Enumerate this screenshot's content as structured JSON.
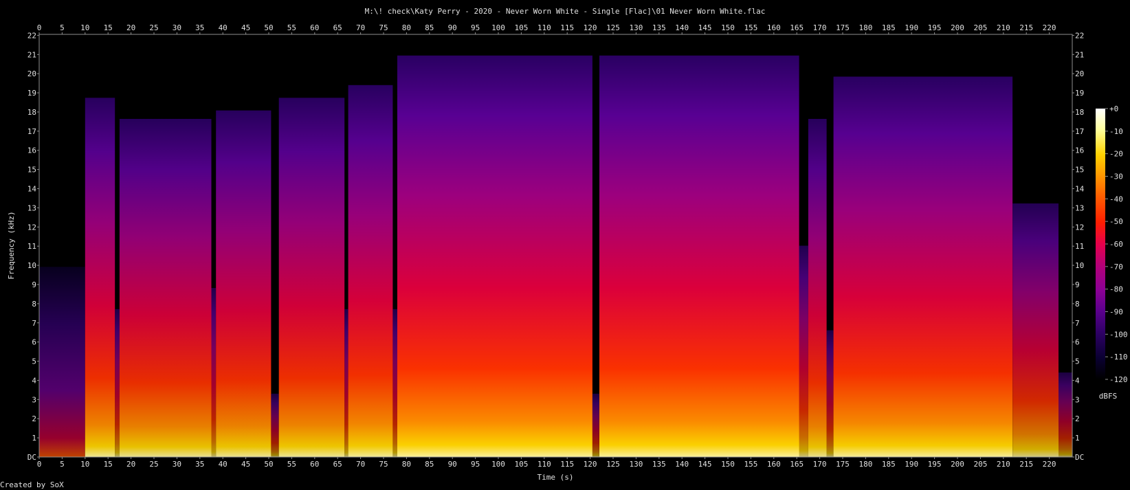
{
  "title": "M:\\! check\\Katy Perry - 2020 - Never Worn White - Single [Flac]\\01 Never Worn White.flac",
  "footer": "Created by SoX",
  "chart_data": {
    "type": "heatmap",
    "title": "M:\\! check\\Katy Perry - 2020 - Never Worn White - Single [Flac]\\01 Never Worn White.flac",
    "xlabel": "Time (s)",
    "ylabel": "Frequency (kHz)",
    "xlim": [
      0,
      225
    ],
    "ylim": [
      0,
      22.05
    ],
    "x_ticks": [
      0,
      5,
      10,
      15,
      20,
      25,
      30,
      35,
      40,
      45,
      50,
      55,
      60,
      65,
      70,
      75,
      80,
      85,
      90,
      95,
      100,
      105,
      110,
      115,
      120,
      125,
      130,
      135,
      140,
      145,
      150,
      155,
      160,
      165,
      170,
      175,
      180,
      185,
      190,
      195,
      200,
      205,
      210,
      215,
      220
    ],
    "y_tick_labels": [
      "DC",
      "1",
      "2",
      "3",
      "4",
      "5",
      "6",
      "7",
      "8",
      "9",
      "10",
      "11",
      "12",
      "13",
      "14",
      "15",
      "16",
      "17",
      "18",
      "19",
      "20",
      "21",
      "22"
    ],
    "colorbar": {
      "label": "dBFS",
      "range": [
        -120,
        0
      ],
      "ticks": [
        "+0",
        "-10",
        "-20",
        "-30",
        "-40",
        "-50",
        "-60",
        "-70",
        "-80",
        "-90",
        "-100",
        "-110",
        "-120"
      ],
      "colors": [
        "#ffffff",
        "#ffff99",
        "#ffd200",
        "#ff9600",
        "#ff5a00",
        "#ff1e00",
        "#e6004b",
        "#b40078",
        "#8c0096",
        "#5a008c",
        "#2d0064",
        "#0a0032",
        "#000000"
      ]
    },
    "time_segments": [
      {
        "start": 0,
        "end": 10,
        "level": 0.45
      },
      {
        "start": 10,
        "end": 16.5,
        "level": 0.85
      },
      {
        "start": 16.5,
        "end": 17.5,
        "level": 0.35
      },
      {
        "start": 17.5,
        "end": 37.5,
        "level": 0.8
      },
      {
        "start": 37.5,
        "end": 38.5,
        "level": 0.4
      },
      {
        "start": 38.5,
        "end": 50.5,
        "level": 0.82
      },
      {
        "start": 50.5,
        "end": 52.2,
        "level": 0.15
      },
      {
        "start": 52.2,
        "end": 66.5,
        "level": 0.85
      },
      {
        "start": 66.5,
        "end": 67.3,
        "level": 0.35
      },
      {
        "start": 67.3,
        "end": 77,
        "level": 0.88
      },
      {
        "start": 77,
        "end": 78,
        "level": 0.35
      },
      {
        "start": 78,
        "end": 120.5,
        "level": 0.95
      },
      {
        "start": 120.5,
        "end": 122,
        "level": 0.15
      },
      {
        "start": 122,
        "end": 165.5,
        "level": 0.95
      },
      {
        "start": 165.5,
        "end": 167.5,
        "level": 0.5
      },
      {
        "start": 167.5,
        "end": 171.5,
        "level": 0.8
      },
      {
        "start": 171.5,
        "end": 173,
        "level": 0.3
      },
      {
        "start": 173,
        "end": 212,
        "level": 0.9
      },
      {
        "start": 212,
        "end": 222,
        "level": 0.6
      },
      {
        "start": 222,
        "end": 225,
        "level": 0.2
      }
    ],
    "grid": false
  }
}
